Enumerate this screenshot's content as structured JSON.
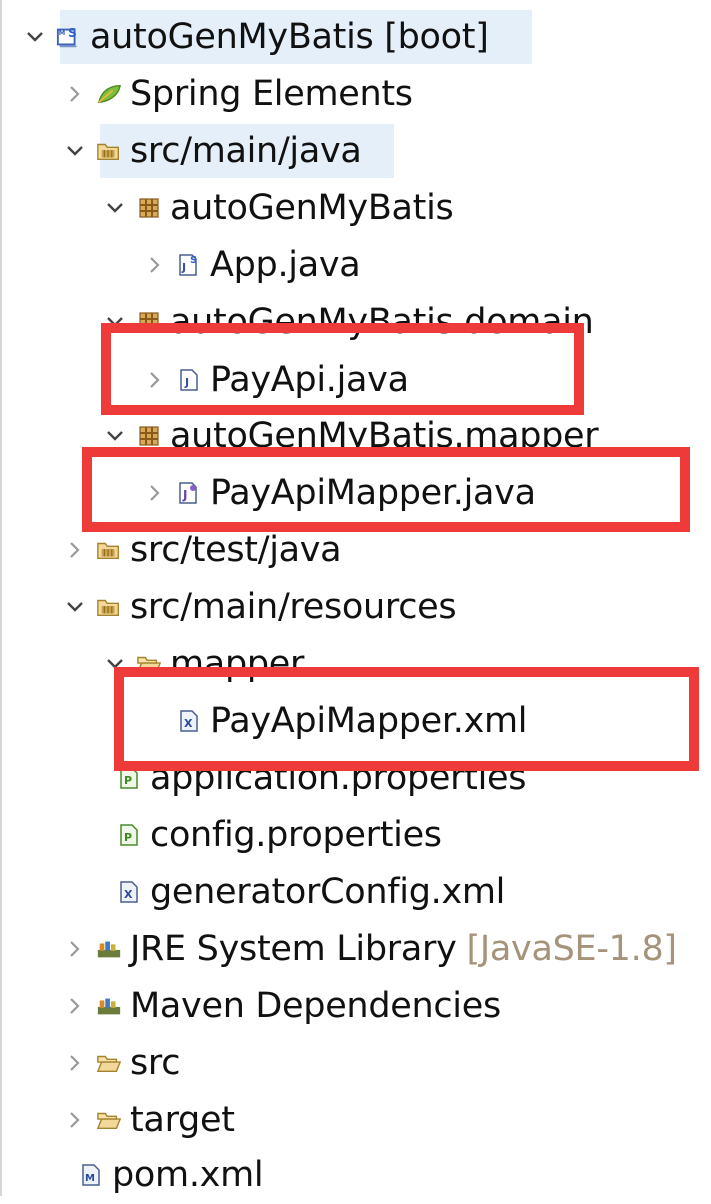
{
  "tree": {
    "project": {
      "label": "autoGenMyBatis [boot]"
    },
    "spring_elements": {
      "label": "Spring Elements"
    },
    "src_main_java": {
      "label": "src/main/java"
    },
    "pkg_root": {
      "label": "autoGenMyBatis"
    },
    "app_java": {
      "label": "App.java"
    },
    "pkg_domain": {
      "label": "autoGenMyBatis.domain"
    },
    "payapi_java": {
      "label": "PayApi.java"
    },
    "pkg_mapper": {
      "label": "autoGenMyBatis.mapper"
    },
    "payapimapper_java": {
      "label": "PayApiMapper.java"
    },
    "src_test_java": {
      "label": "src/test/java"
    },
    "src_main_resources": {
      "label": "src/main/resources"
    },
    "mapper_folder": {
      "label": "mapper"
    },
    "payapimapper_xml": {
      "label": "PayApiMapper.xml"
    },
    "application_properties": {
      "label": "application.properties"
    },
    "config_properties": {
      "label": "config.properties"
    },
    "generator_config": {
      "label": "generatorConfig.xml"
    },
    "jre_library": {
      "label": "JRE System Library",
      "decoration": "[JavaSE-1.8]"
    },
    "maven_deps": {
      "label": "Maven Dependencies"
    },
    "src_folder": {
      "label": "src"
    },
    "target_folder": {
      "label": "target"
    },
    "pom_xml": {
      "label": "pom.xml"
    }
  },
  "colors": {
    "highlight_box": "#ef3a3a",
    "selection": "#e4effa",
    "decoration_text": "#a5937a"
  }
}
